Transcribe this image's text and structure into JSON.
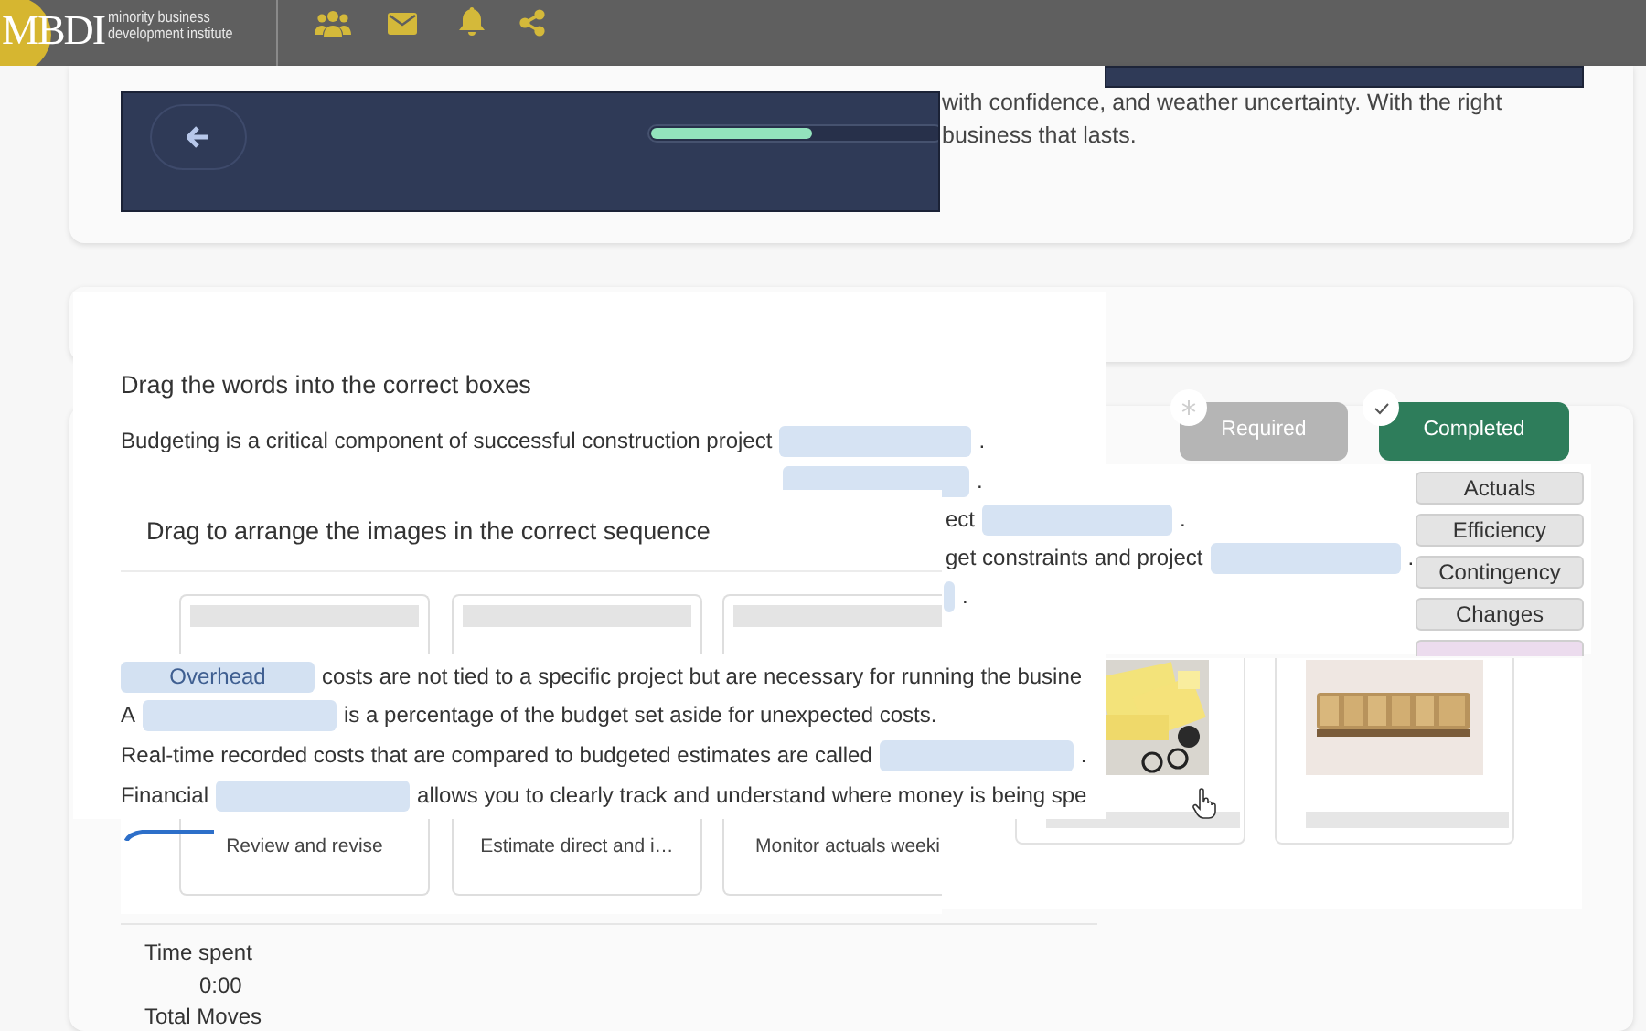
{
  "header": {
    "logo_mark": "MBDI",
    "logo_lines": [
      "minority business",
      "development institute"
    ]
  },
  "intro": {
    "lines": [
      "with confidence, and weather uncertainty. With the right",
      "business that lasts."
    ]
  },
  "progress": {
    "level": 0.56
  },
  "status_buttons": [
    {
      "label": "Required",
      "selected": false
    },
    {
      "label": "Completed",
      "selected": true
    }
  ],
  "fill_blanks": {
    "title": "Drag the words into the correct boxes",
    "first_sentence": [
      {
        "kind": "text",
        "text": "Budgeting is a critical component of successful construction project"
      },
      {
        "kind": "blank"
      },
      {
        "kind": "text",
        "text": "."
      }
    ],
    "peeking_lines": [
      [
        {
          "kind": "blank"
        },
        {
          "kind": "text",
          "text": "."
        }
      ],
      [
        {
          "kind": "text",
          "text": "ect"
        },
        {
          "kind": "blank"
        },
        {
          "kind": "text",
          "text": "."
        }
      ],
      [
        {
          "kind": "text",
          "text": "get constraints and project"
        },
        {
          "kind": "blank"
        },
        {
          "kind": "text",
          "text": "."
        }
      ],
      [
        {
          "kind": "blank"
        },
        {
          "kind": "text",
          "text": "."
        }
      ]
    ],
    "sentences": [
      [
        {
          "kind": "blank",
          "value": "Overhead"
        },
        {
          "kind": "text",
          "text": "costs are not tied to a specific project but are necessary for running the busine"
        }
      ],
      [
        {
          "kind": "text",
          "text": "A"
        },
        {
          "kind": "blank"
        },
        {
          "kind": "text",
          "text": "is a percentage of the budget set aside for unexpected costs."
        }
      ],
      [
        {
          "kind": "text",
          "text": "Real-time recorded costs that are compared to budgeted estimates are called"
        },
        {
          "kind": "blank"
        },
        {
          "kind": "text",
          "text": "."
        }
      ],
      [
        {
          "kind": "text",
          "text": "Financial"
        },
        {
          "kind": "blank"
        },
        {
          "kind": "text",
          "text": "allows you to clearly track and understand where money is being spe"
        }
      ]
    ]
  },
  "word_bank": [
    {
      "label": "Actuals",
      "color": "#e4e4e4"
    },
    {
      "label": "Efficiency",
      "color": "#e4e4e4"
    },
    {
      "label": "Contingency",
      "color": "#e4e4e4"
    },
    {
      "label": "Changes",
      "color": "#e4e4e4"
    },
    {
      "color": "#ecdcee"
    }
  ],
  "sequence": {
    "title": "Drag to arrange the images in the correct sequence",
    "cards": [
      {
        "caption": "Review and revise"
      },
      {
        "caption": "Estimate direct and i…"
      },
      {
        "caption": "Monitor actuals weeki"
      }
    ]
  },
  "stats": {
    "time_label": "Time spent",
    "time_value": "0:00",
    "moves_label": "Total Moves"
  }
}
